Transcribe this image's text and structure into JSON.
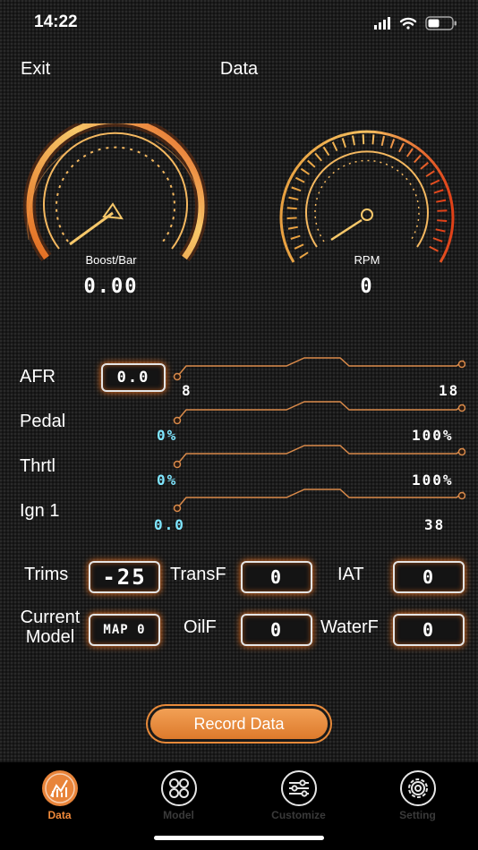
{
  "status": {
    "time": "14:22"
  },
  "nav": {
    "exit": "Exit",
    "title": "Data"
  },
  "gauges": [
    {
      "label": "Boost/Bar",
      "value": "0.00"
    },
    {
      "label": "RPM",
      "value": "0"
    }
  ],
  "rows": [
    {
      "label": "AFR",
      "box": "0.0",
      "min": "8",
      "max": "18",
      "tick_color": "white"
    },
    {
      "label": "Pedal",
      "min": "0%",
      "max": "100%",
      "tick_color": "cyan-white"
    },
    {
      "label": "Thrtl",
      "min": "0%",
      "max": "100%",
      "tick_color": "cyan-white"
    },
    {
      "label": "Ign 1",
      "min": "0.0",
      "max": "38",
      "tick_color": "cyan-white"
    }
  ],
  "readouts": {
    "trims": {
      "label": "Trims",
      "value": "-25"
    },
    "transf": {
      "label": "TransF",
      "value": "0"
    },
    "iat": {
      "label": "IAT",
      "value": "0"
    },
    "current_model": {
      "label_line1": "Current",
      "label_line2": "Model",
      "value": "MAP 0"
    },
    "oilf": {
      "label": "OilF",
      "value": "0"
    },
    "waterf": {
      "label": "WaterF",
      "value": "0"
    }
  },
  "record_button": "Record Data",
  "tabs": [
    {
      "label": "Data",
      "icon": "chart-icon",
      "active": true
    },
    {
      "label": "Model",
      "icon": "grid-circles-icon",
      "active": false
    },
    {
      "label": "Customize",
      "icon": "sliders-icon",
      "active": false
    },
    {
      "label": "Setting",
      "icon": "gear-icon",
      "active": false
    }
  ],
  "colors": {
    "accent": "#f08a3a",
    "cyan": "#7fe6ff",
    "background": "#1a1a1a"
  }
}
